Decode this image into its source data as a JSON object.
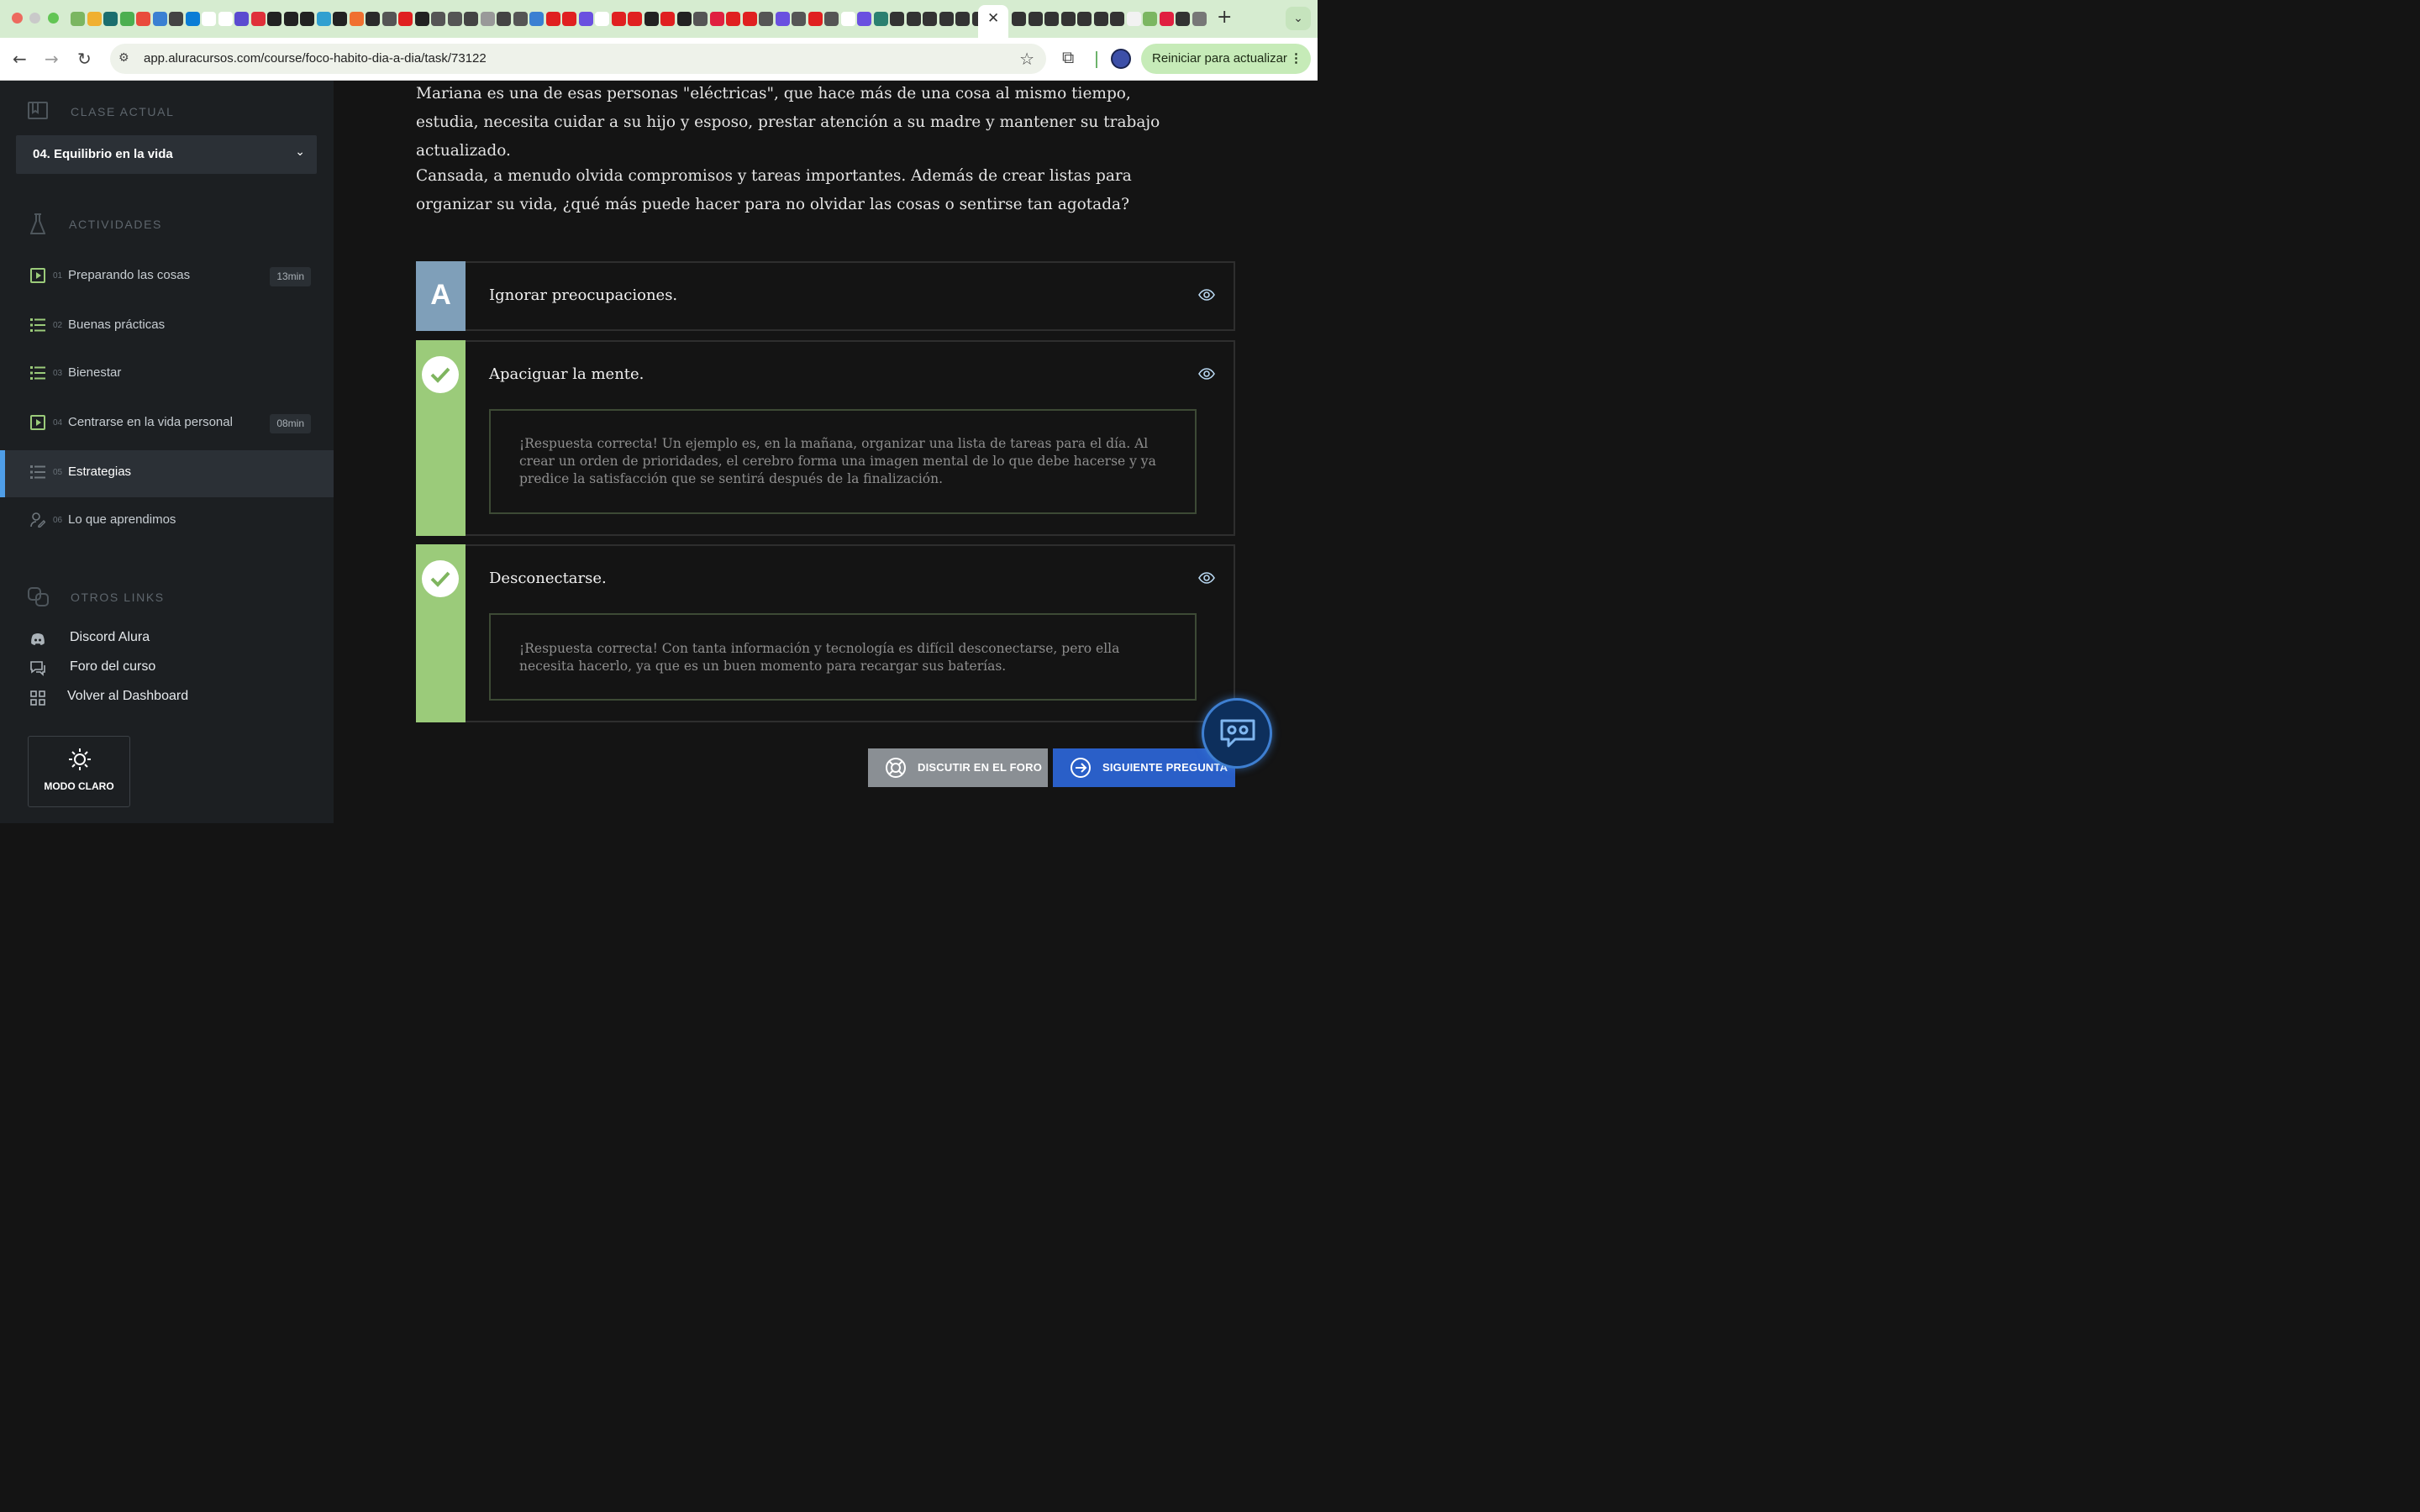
{
  "browser": {
    "url": "app.aluracursos.com/course/foco-habito-dia-a-dia/task/73122",
    "update_button": "Reiniciar para actualizar",
    "close_tab_symbol": "✕",
    "new_tab_symbol": "+"
  },
  "sidebar": {
    "current_class_title": "CLASE ACTUAL",
    "current_class_value": "04. Equilibrio en la vida",
    "activities_title": "ACTIVIDADES",
    "activities": [
      {
        "num": "01",
        "label": "Preparando las cosas",
        "duration": "13min",
        "icon": "video-icon"
      },
      {
        "num": "02",
        "label": "Buenas prácticas",
        "duration": "",
        "icon": "list-icon"
      },
      {
        "num": "03",
        "label": "Bienestar",
        "duration": "",
        "icon": "list-icon"
      },
      {
        "num": "04",
        "label": "Centrarse en la vida personal",
        "duration": "08min",
        "icon": "video-icon"
      },
      {
        "num": "05",
        "label": "Estrategias",
        "duration": "",
        "icon": "list-icon"
      },
      {
        "num": "06",
        "label": "Lo que aprendimos",
        "duration": "",
        "icon": "person-icon"
      }
    ],
    "other_links_title": "OTROS LINKS",
    "links": [
      {
        "label": "Discord Alura",
        "icon": "discord-icon"
      },
      {
        "label": "Foro del curso",
        "icon": "forum-icon"
      },
      {
        "label": "Volver al Dashboard",
        "icon": "dashboard-icon"
      }
    ],
    "mode_button": "MODO CLARO"
  },
  "main": {
    "paragraph_1": "Mariana es una de esas personas \"eléctricas\", que hace más de una cosa al mismo tiempo, estudia, necesita cuidar a su hijo y esposo, prestar atención a su madre y mantener su trabajo actualizado.",
    "paragraph_2": "Cansada, a menudo olvida compromisos y tareas importantes. Además de crear listas para organizar su vida, ¿qué más puede hacer para no olvidar las cosas o sentirse tan agotada?",
    "options": [
      {
        "letter": "A",
        "text": "Ignorar preocupaciones.",
        "correct": false,
        "feedback": ""
      },
      {
        "letter": "",
        "text": "Apaciguar la mente.",
        "correct": true,
        "feedback": "¡Respuesta correcta! Un ejemplo es, en la mañana, organizar una lista de tareas para el día. Al crear un orden de prioridades, el cerebro forma una imagen mental de lo que debe hacerse y ya predice la satisfacción que se sentirá después de la finalización."
      },
      {
        "letter": "",
        "text": "Desconectarse.",
        "correct": true,
        "feedback": "¡Respuesta correcta! Con tanta información y tecnología es difícil desconectarse, pero ella necesita hacerlo, ya que es un buen momento para recargar sus baterías."
      }
    ],
    "discuss_button": "DISCUTIR EN EL FORO",
    "next_button": "SIGUIENTE PREGUNTA"
  },
  "colors": {
    "accent_green": "#9bcb7a",
    "letter_blue": "#7f9fb9",
    "next_blue": "#2a5fc8",
    "discuss_gray": "#8a8f94",
    "active_bar": "#4f9ee8"
  }
}
